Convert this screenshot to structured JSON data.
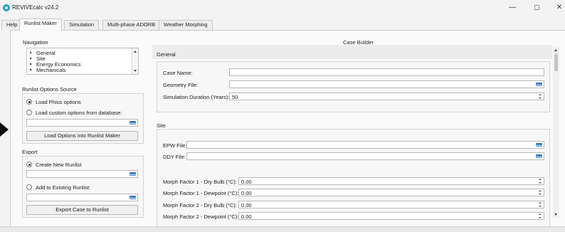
{
  "window": {
    "title": "REVIVEcalc v24.2",
    "minimize": "—",
    "maximize": "☐",
    "close": "✕"
  },
  "tabs": [
    {
      "label": "Help"
    },
    {
      "label": "Runlist Maker"
    },
    {
      "label": "Simulation"
    },
    {
      "label": "Multi-phase ADORB"
    },
    {
      "label": "Weather Morphing"
    }
  ],
  "left": {
    "navigation": {
      "title": "Navigation",
      "items": [
        "General",
        "Site",
        "Energy Economics",
        "Mechanicals"
      ]
    },
    "options_source": {
      "title": "Runlist Options Source",
      "load_phius": "Load Phius options",
      "load_custom": "Load custom options from database:",
      "custom_path": "",
      "load_button": "Load Options into Runlist Maker"
    },
    "export": {
      "title": "Export",
      "create_new": "Create New Runlist",
      "create_path": "",
      "add_existing": "Add to Existing Runlist:",
      "existing_path": "",
      "export_button": "Export Case to Runlist"
    }
  },
  "case_builder": {
    "title": "Case Builder",
    "general": {
      "title": "General",
      "case_name_label": "Case Name:",
      "case_name_value": "",
      "geometry_label": "Geometry File:",
      "geometry_value": "",
      "duration_label": "Simulation Duration (Years):",
      "duration_value": "50"
    },
    "site": {
      "title": "Site",
      "epw_label": "EPW File:",
      "epw_value": "",
      "ddy_label": "DDY File:",
      "ddy_value": "",
      "morph_factors": [
        {
          "label": "Morph Factor 1 - Dry Bulb (°C):",
          "value": "0.00"
        },
        {
          "label": "Morph Factor 1 - Dewpoint (°C):",
          "value": "0.00"
        },
        {
          "label": "Morph Factor 2 - Dry Bulb (°C):",
          "value": "0.00"
        },
        {
          "label": "Morph Factor 2 - Dewpoint (°C):",
          "value": "0.00"
        }
      ]
    }
  },
  "colors": {
    "accent": "#1fa3c9",
    "file_button": "#3f86c9",
    "background": "#f3f3f3"
  }
}
